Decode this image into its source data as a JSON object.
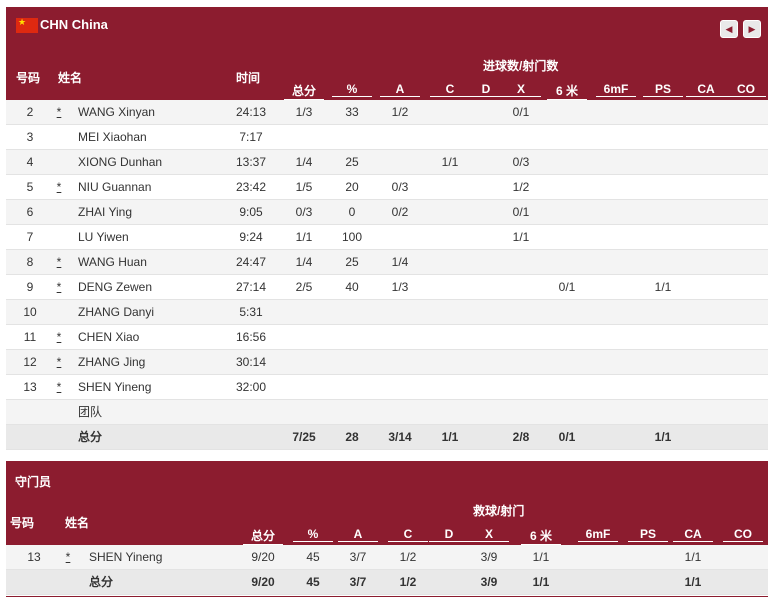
{
  "team": {
    "code_name": "CHN China",
    "flag_color": "#de2910",
    "accent_color": "#8c1c2f"
  },
  "nav": {
    "prev_icon": "◀",
    "next_icon": "▶"
  },
  "players_header": {
    "number": "号码",
    "name": "姓名",
    "time": "时间",
    "group": "进球数/射门数",
    "cols": [
      "总分",
      "%",
      "A",
      "C",
      "D",
      "X",
      "6 米",
      "6mF",
      "PS",
      "CA",
      "CO"
    ]
  },
  "players": [
    {
      "no": "2",
      "star": "*",
      "name": "WANG Xinyan",
      "time": "24:13",
      "total": "1/3",
      "pct": "33",
      "A": "1/2",
      "C": "",
      "D": "",
      "X": "0/1",
      "m6": "",
      "m6f": "",
      "PS": "",
      "CA": "",
      "CO": ""
    },
    {
      "no": "3",
      "star": "",
      "name": "MEI Xiaohan",
      "time": "7:17",
      "total": "",
      "pct": "",
      "A": "",
      "C": "",
      "D": "",
      "X": "",
      "m6": "",
      "m6f": "",
      "PS": "",
      "CA": "",
      "CO": ""
    },
    {
      "no": "4",
      "star": "",
      "name": "XIONG Dunhan",
      "time": "13:37",
      "total": "1/4",
      "pct": "25",
      "A": "",
      "C": "1/1",
      "D": "",
      "X": "0/3",
      "m6": "",
      "m6f": "",
      "PS": "",
      "CA": "",
      "CO": ""
    },
    {
      "no": "5",
      "star": "*",
      "name": "NIU Guannan",
      "time": "23:42",
      "total": "1/5",
      "pct": "20",
      "A": "0/3",
      "C": "",
      "D": "",
      "X": "1/2",
      "m6": "",
      "m6f": "",
      "PS": "",
      "CA": "",
      "CO": ""
    },
    {
      "no": "6",
      "star": "",
      "name": "ZHAI Ying",
      "time": "9:05",
      "total": "0/3",
      "pct": "0",
      "A": "0/2",
      "C": "",
      "D": "",
      "X": "0/1",
      "m6": "",
      "m6f": "",
      "PS": "",
      "CA": "",
      "CO": ""
    },
    {
      "no": "7",
      "star": "",
      "name": "LU Yiwen",
      "time": "9:24",
      "total": "1/1",
      "pct": "100",
      "A": "",
      "C": "",
      "D": "",
      "X": "1/1",
      "m6": "",
      "m6f": "",
      "PS": "",
      "CA": "",
      "CO": ""
    },
    {
      "no": "8",
      "star": "*",
      "name": "WANG Huan",
      "time": "24:47",
      "total": "1/4",
      "pct": "25",
      "A": "1/4",
      "C": "",
      "D": "",
      "X": "",
      "m6": "",
      "m6f": "",
      "PS": "",
      "CA": "",
      "CO": ""
    },
    {
      "no": "9",
      "star": "*",
      "name": "DENG Zewen",
      "time": "27:14",
      "total": "2/5",
      "pct": "40",
      "A": "1/3",
      "C": "",
      "D": "",
      "X": "",
      "m6": "0/1",
      "m6f": "",
      "PS": "1/1",
      "CA": "",
      "CO": ""
    },
    {
      "no": "10",
      "star": "",
      "name": "ZHANG Danyi",
      "time": "5:31",
      "total": "",
      "pct": "",
      "A": "",
      "C": "",
      "D": "",
      "X": "",
      "m6": "",
      "m6f": "",
      "PS": "",
      "CA": "",
      "CO": ""
    },
    {
      "no": "11",
      "star": "*",
      "name": "CHEN Xiao",
      "time": "16:56",
      "total": "",
      "pct": "",
      "A": "",
      "C": "",
      "D": "",
      "X": "",
      "m6": "",
      "m6f": "",
      "PS": "",
      "CA": "",
      "CO": ""
    },
    {
      "no": "12",
      "star": "*",
      "name": "ZHANG Jing",
      "time": "30:14",
      "total": "",
      "pct": "",
      "A": "",
      "C": "",
      "D": "",
      "X": "",
      "m6": "",
      "m6f": "",
      "PS": "",
      "CA": "",
      "CO": ""
    },
    {
      "no": "13",
      "star": "*",
      "name": "SHEN Yineng",
      "time": "32:00",
      "total": "",
      "pct": "",
      "A": "",
      "C": "",
      "D": "",
      "X": "",
      "m6": "",
      "m6f": "",
      "PS": "",
      "CA": "",
      "CO": ""
    }
  ],
  "team_row": {
    "label": "团队"
  },
  "players_total": {
    "label": "总分",
    "total": "7/25",
    "pct": "28",
    "A": "3/14",
    "C": "1/1",
    "D": "",
    "X": "2/8",
    "m6": "0/1",
    "m6f": "",
    "PS": "1/1",
    "CA": "",
    "CO": ""
  },
  "goalkeepers_header": {
    "title": "守门员",
    "number": "号码",
    "name": "姓名",
    "group": "救球/射门",
    "cols": [
      "总分",
      "%",
      "A",
      "C",
      "D",
      "X",
      "6 米",
      "6mF",
      "PS",
      "CA",
      "CO"
    ]
  },
  "goalkeepers": [
    {
      "no": "13",
      "star": "*",
      "name": "SHEN Yineng",
      "total": "9/20",
      "pct": "45",
      "A": "3/7",
      "C": "1/2",
      "D": "",
      "X": "3/9",
      "m6": "1/1",
      "m6f": "",
      "PS": "",
      "CA": "1/1",
      "CO": ""
    }
  ],
  "goalkeepers_total": {
    "label": "总分",
    "total": "9/20",
    "pct": "45",
    "A": "3/7",
    "C": "1/2",
    "D": "",
    "X": "3/9",
    "m6": "1/1",
    "m6f": "",
    "PS": "",
    "CA": "1/1",
    "CO": ""
  }
}
